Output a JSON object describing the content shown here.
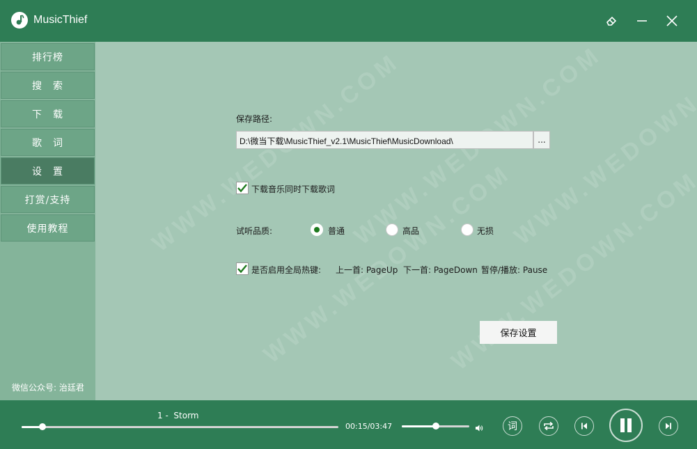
{
  "app": {
    "title": "MusicThief"
  },
  "sidebar": {
    "items": [
      {
        "label": "排行榜",
        "active": false
      },
      {
        "label": "搜　索",
        "active": false
      },
      {
        "label": "下　载",
        "active": false
      },
      {
        "label": "歌　词",
        "active": false
      },
      {
        "label": "设　置",
        "active": true
      },
      {
        "label": "打赏/支持",
        "active": false
      },
      {
        "label": "使用教程",
        "active": false
      }
    ],
    "footer": "微信公众号: 治廷君"
  },
  "settings": {
    "save_path_label": "保存路径:",
    "save_path_value": "D:\\微当下载\\MusicThief_v2.1\\MusicThief\\MusicDownload\\",
    "browse_label": "...",
    "download_lyrics_label": "下载音乐同时下载歌词",
    "download_lyrics_checked": true,
    "quality_label": "试听品质:",
    "quality_options": [
      {
        "label": "普通",
        "checked": true
      },
      {
        "label": "高品",
        "checked": false
      },
      {
        "label": "无损",
        "checked": false
      }
    ],
    "hotkey_label": "是否启用全局热键:",
    "hotkey_checked": true,
    "hotkey_prev": "上一首: PageUp",
    "hotkey_next": "下一首: PageDown",
    "hotkey_pause": "暂停/播放: Pause",
    "save_button": "保存设置"
  },
  "player": {
    "song": "1 -  Storm",
    "time": "00:15/03:47",
    "progress": 0.066,
    "volume": 0.5,
    "lyric_button": "词"
  },
  "watermark": "WWW.WEDOWN.COM",
  "colors": {
    "titlebar": "#2e7d55",
    "sidebar": "#84b49a",
    "sidebar_active": "#4a7c62",
    "content": "#a4c7b5",
    "check": "#1e7a1e"
  }
}
